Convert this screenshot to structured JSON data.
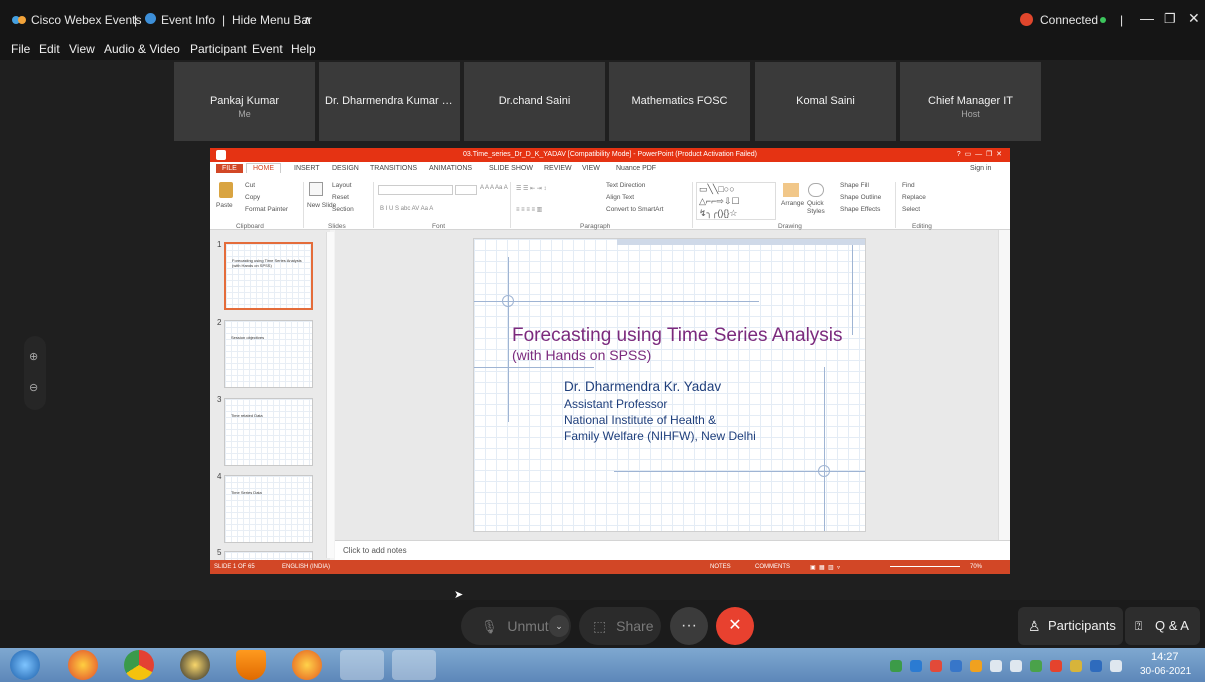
{
  "titlebar": {
    "app": "Cisco Webex Events",
    "event_info": "Event Info",
    "hide_menu": "Hide Menu Bar",
    "hide_menu_caret": "∧",
    "connected": "Connected",
    "connected_dot_color": "#3cc55c",
    "record_color": "#e0462c"
  },
  "menubar": {
    "file": "File",
    "edit": "Edit",
    "view": "View",
    "audio_video": "Audio & Video",
    "participant": "Participant",
    "event": "Event",
    "help": "Help"
  },
  "participants": [
    {
      "name": "Pankaj Kumar",
      "role": "Me"
    },
    {
      "name": "Dr. Dharmendra Kumar Y...",
      "role": ""
    },
    {
      "name": "Dr.chand Saini",
      "role": ""
    },
    {
      "name": "Mathematics FOSC",
      "role": ""
    },
    {
      "name": "Komal Saini",
      "role": ""
    },
    {
      "name": "Chief Manager IT",
      "role": "Host"
    }
  ],
  "ppt": {
    "window_title": "03.Time_series_Dr_D_K_YADAV [Compatibility Mode] - PowerPoint (Product Activation Failed)",
    "tabs": [
      "FILE",
      "HOME",
      "INSERT",
      "DESIGN",
      "TRANSITIONS",
      "ANIMATIONS",
      "SLIDE SHOW",
      "REVIEW",
      "VIEW",
      "Nuance PDF"
    ],
    "sign_in": "Sign in",
    "ribbon": {
      "cut": "Cut",
      "copy": "Copy",
      "paste": "Paste",
      "format_painter": "Format Painter",
      "clipboard": "Clipboard",
      "new_slide": "New Slide",
      "layout": "Layout",
      "reset": "Reset",
      "section": "Section",
      "slides": "Slides",
      "font": "Font",
      "paragraph": "Paragraph",
      "text_direction": "Text Direction",
      "align_text": "Align Text",
      "convert_smartart": "Convert to SmartArt",
      "arrange": "Arrange",
      "quick_styles": "Quick Styles",
      "shape_fill": "Shape Fill",
      "shape_outline": "Shape Outline",
      "shape_effects": "Shape Effects",
      "drawing": "Drawing",
      "find": "Find",
      "replace": "Replace",
      "select": "Select",
      "editing": "Editing"
    },
    "thumbs": [
      {
        "num": "1",
        "text": "Forecasting using Time Series Analysis (with Hands on SPSS)"
      },
      {
        "num": "2",
        "text": "Session objectives"
      },
      {
        "num": "3",
        "text": "Time related Data"
      },
      {
        "num": "4",
        "text": "Time Series Data"
      },
      {
        "num": "5",
        "text": ""
      }
    ],
    "slide": {
      "title": "Forecasting using Time Series Analysis",
      "subtitle": "(with Hands on SPSS)",
      "author": "Dr. Dharmendra Kr. Yadav",
      "position": "Assistant Professor",
      "org1": "National Institute of Health &",
      "org2": "Family Welfare (NIHFW), New Delhi"
    },
    "notes_placeholder": "Click to add notes",
    "status": {
      "slide": "SLIDE 1 OF 65",
      "language": "ENGLISH (INDIA)",
      "notes": "NOTES",
      "comments": "COMMENTS",
      "zoom": "70%"
    }
  },
  "controls": {
    "unmute": "Unmute",
    "share": "Share",
    "more": "···",
    "leave": "✕",
    "participants": "Participants",
    "qa": "Q & A"
  },
  "taskbar": {
    "time": "14:27",
    "date": "30-06-2021"
  }
}
